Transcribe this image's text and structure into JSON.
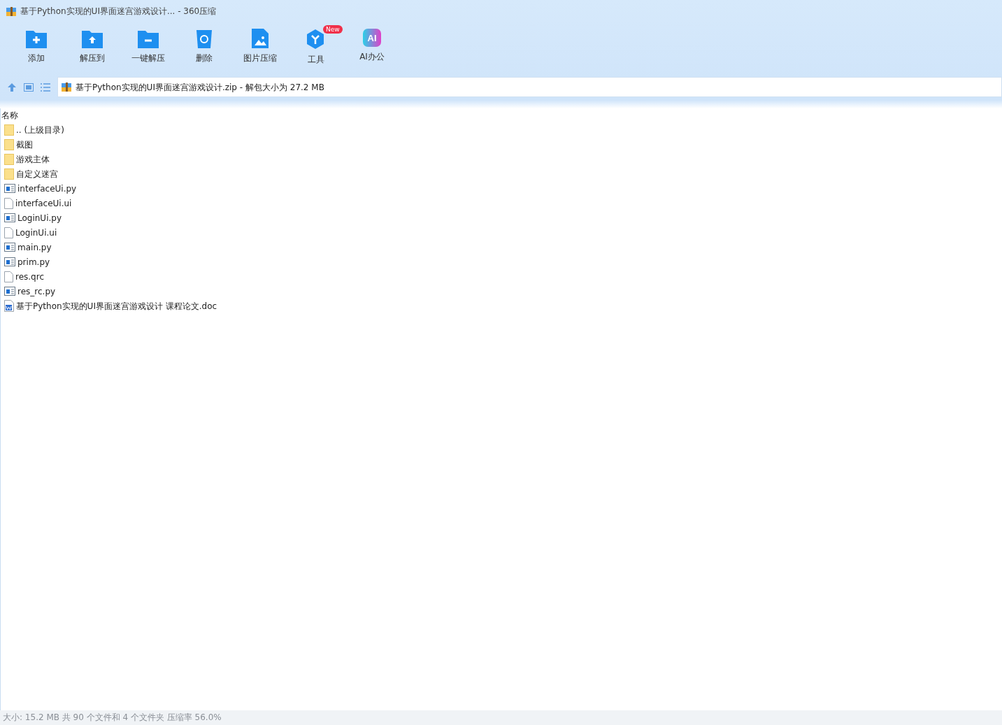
{
  "window": {
    "title": "基于Python实现的UI界面迷宫游戏设计... - 360压缩"
  },
  "toolbar": [
    {
      "label": "添加"
    },
    {
      "label": "解压到"
    },
    {
      "label": "一键解压"
    },
    {
      "label": "删除"
    },
    {
      "label": "图片压缩"
    },
    {
      "label": "工具",
      "badge": "New"
    },
    {
      "label": "AI办公",
      "icon_text": "AI"
    }
  ],
  "address_bar": {
    "value": "基于Python实现的UI界面迷宫游戏设计.zip - 解包大小为 27.2 MB"
  },
  "file_list": {
    "columns": [
      "名称"
    ],
    "rows": [
      {
        "name": ".. (上级目录)",
        "kind": "folder"
      },
      {
        "name": "截图",
        "kind": "folder"
      },
      {
        "name": "游戏主体",
        "kind": "folder"
      },
      {
        "name": "自定义迷宫",
        "kind": "folder"
      },
      {
        "name": "interfaceUi.py",
        "kind": "script"
      },
      {
        "name": "interfaceUi.ui",
        "kind": "file"
      },
      {
        "name": "LoginUi.py",
        "kind": "script"
      },
      {
        "name": "LoginUi.ui",
        "kind": "file"
      },
      {
        "name": "main.py",
        "kind": "script"
      },
      {
        "name": "prim.py",
        "kind": "script"
      },
      {
        "name": "res.qrc",
        "kind": "file"
      },
      {
        "name": "res_rc.py",
        "kind": "script"
      },
      {
        "name": "基于Python实现的UI界面迷宫游戏设计 课程论文.doc",
        "kind": "doc"
      }
    ]
  },
  "status_bar": "大小: 15.2 MB 共 90 个文件和 4 个文件夹 压缩率 56.0%"
}
